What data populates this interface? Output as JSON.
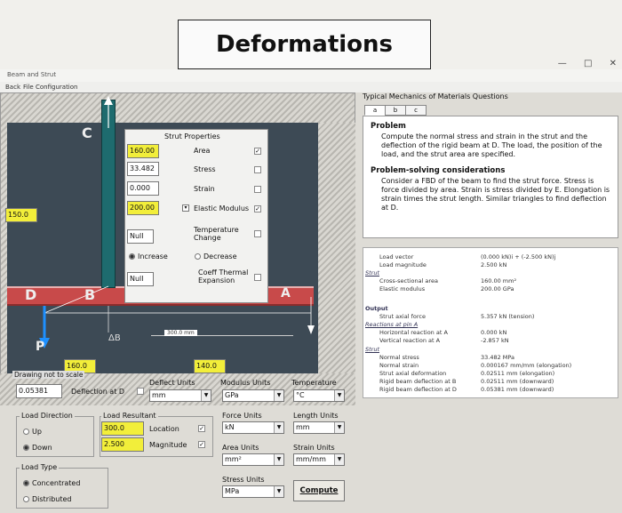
{
  "banner": {
    "title": "Deformations"
  },
  "window": {
    "title": "Beam and Strut",
    "controls": [
      "—",
      "□",
      "✕"
    ]
  },
  "menu": {
    "items": [
      "Back",
      "File",
      "Configuration"
    ]
  },
  "drawing": {
    "labels": {
      "c": "C",
      "d": "D",
      "b": "B",
      "a": "A",
      "p": "P",
      "ab": "ΔB"
    },
    "left_value": "150.0",
    "dim_label": "300.0 mm",
    "drawing_note": "Drawing not to scale",
    "beam_field_value": "160.0",
    "load_field_value": "140.0"
  },
  "strut_props": {
    "title": "Strut Properties",
    "area_value": "160.00",
    "area_label": "Area",
    "stress_value": "33.482",
    "stress_label": "Stress",
    "strain_value": "0.000",
    "strain_label": "Strain",
    "modulus_value": "200.00",
    "modulus_label": "Elastic Modulus",
    "temp_value": "Null",
    "temp_label": "Temperature Change",
    "increase_label": "Increase",
    "decrease_label": "Decrease",
    "coeff_value": "Null",
    "coeff_label": "Coeff Thermal Expansion"
  },
  "controls": {
    "deflection_value": "0.05381",
    "deflection_label": "Deflection at D",
    "deflect_units": {
      "title": "Deflect Units",
      "value": "mm"
    },
    "modulus_units": {
      "title": "Modulus Units",
      "value": "GPa"
    },
    "temperature": {
      "title": "Temperature",
      "value": "°C"
    },
    "load_direction": {
      "title": "Load Direction",
      "up": "Up",
      "down": "Down"
    },
    "load_resultant": {
      "title": "Load Resultant",
      "location_value": "300.0",
      "location_label": "Location",
      "magnitude_value": "2.500",
      "magnitude_label": "Magnitude"
    },
    "force_units": {
      "title": "Force Units",
      "value": "kN"
    },
    "length_units": {
      "title": "Length Units",
      "value": "mm"
    },
    "area_units": {
      "title": "Area Units",
      "value": "mm²"
    },
    "strain_units": {
      "title": "Strain Units",
      "value": "mm/mm"
    },
    "stress_units": {
      "title": "Stress Units",
      "value": "MPa"
    },
    "load_type": {
      "title": "Load Type",
      "concentrated": "Concentrated",
      "distributed": "Distributed"
    },
    "compute_label": "Compute"
  },
  "right_panel": {
    "title": "Typical Mechanics of Materials Questions",
    "tabs": [
      "a",
      "b",
      "c"
    ],
    "problem_heading": "Problem",
    "problem_text": "Compute the normal stress and strain in the strut and the deflection of the rigid beam at D. The load, the position of the load, and the strut area are specified.",
    "considerations_heading": "Problem-solving considerations",
    "considerations_text": "Consider a FBD of the beam to find the strut force. Stress is force divided by area. Strain is stress divided by E. Elongation is strain times the strut length. Similar triangles to find deflection at D."
  },
  "results": {
    "load_vector_label": "Load vector",
    "load_vector_value": "(0.000 kN)i + (-2.500 kN)j",
    "load_magnitude_label": "Load magnitude",
    "load_magnitude_value": "2.500 kN",
    "strut_heading": "Strut",
    "cross_section_label": "Cross-sectional area",
    "cross_section_value": "160.00 mm²",
    "elastic_label": "Elastic modulus",
    "elastic_value": "200.00 GPa",
    "output_heading": "Output",
    "axial_force_label": "Strut axial force",
    "axial_force_value": "5.357 kN (tension)",
    "reactions_heading": "Reactions at pin A",
    "horiz_label": "Horizontal reaction at A",
    "horiz_value": "0.000 kN",
    "vert_label": "Vertical reaction at A",
    "vert_value": "-2.857 kN",
    "strut_heading2": "Strut",
    "normal_stress_label": "Normal stress",
    "normal_stress_value": "33.482 MPa",
    "normal_strain_label": "Normal strain",
    "normal_strain_value": "0.000167 mm/mm (elongation)",
    "axial_def_label": "Strut axial deformation",
    "axial_def_value": "0.02511 mm (elongation)",
    "defl_b_label": "Rigid beam deflection at B",
    "defl_b_value": "0.02511 mm (downward)",
    "defl_d_label": "Rigid beam deflection at D",
    "defl_d_value": "0.05381 mm (downward)"
  },
  "colors": {
    "field_highlight": "#f2ee3a",
    "beam": "#c84a4a",
    "strut": "#1e6b6e",
    "canvas": "#3d4a55"
  }
}
